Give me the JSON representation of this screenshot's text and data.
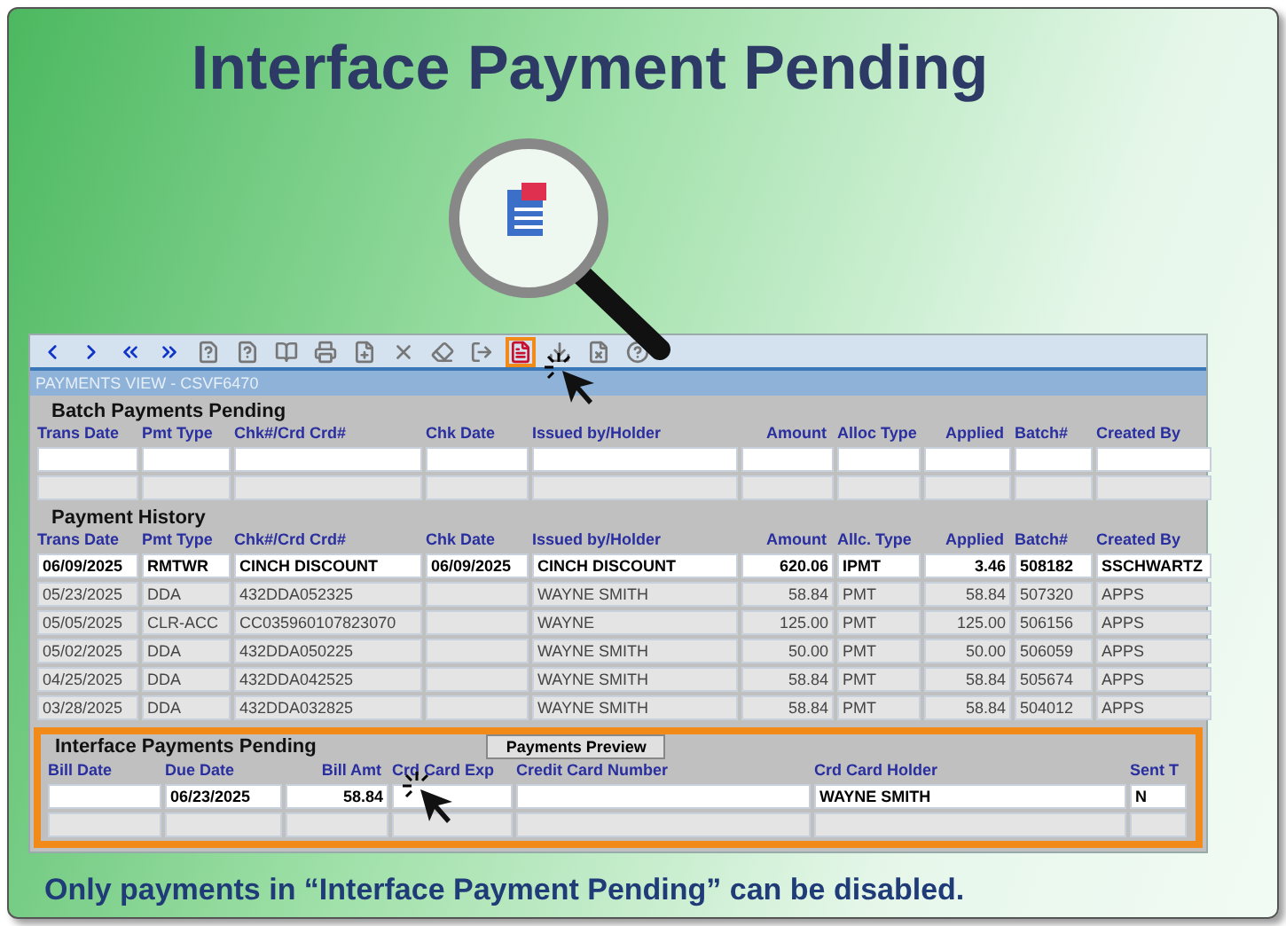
{
  "title": "Interface Payment Pending",
  "toolbar": [
    {
      "kind": "prev",
      "highlighted": false
    },
    {
      "kind": "next",
      "highlighted": false
    },
    {
      "kind": "first",
      "highlighted": false
    },
    {
      "kind": "last",
      "highlighted": false
    },
    {
      "kind": "query",
      "highlighted": false
    },
    {
      "kind": "query",
      "highlighted": false
    },
    {
      "kind": "book",
      "highlighted": false
    },
    {
      "kind": "print",
      "highlighted": false
    },
    {
      "kind": "new",
      "highlighted": false
    },
    {
      "kind": "delete",
      "highlighted": false
    },
    {
      "kind": "erase",
      "highlighted": false
    },
    {
      "kind": "exit",
      "highlighted": false
    },
    {
      "kind": "payments",
      "highlighted": true
    },
    {
      "kind": "download",
      "highlighted": false
    },
    {
      "kind": "clear",
      "highlighted": false
    },
    {
      "kind": "help",
      "highlighted": false
    }
  ],
  "window_title": "PAYMENTS VIEW - CSVF6470",
  "batch": {
    "heading": "Batch Payments Pending",
    "columns": [
      {
        "label": "Trans Date",
        "kind": "text"
      },
      {
        "label": "Pmt Type",
        "kind": "text"
      },
      {
        "label": "Chk#/Crd Crd#",
        "kind": "text"
      },
      {
        "label": "Chk Date",
        "kind": "text"
      },
      {
        "label": "Issued by/Holder",
        "kind": "text"
      },
      {
        "label": "Amount",
        "kind": "number"
      },
      {
        "label": "Alloc Type",
        "kind": "text"
      },
      {
        "label": "Applied",
        "kind": "number"
      },
      {
        "label": "Batch#",
        "kind": "text"
      },
      {
        "label": "Created By",
        "kind": "text"
      }
    ]
  },
  "history": {
    "heading": "Payment History",
    "columns": [
      {
        "label": "Trans Date",
        "kind": "text"
      },
      {
        "label": "Pmt Type",
        "kind": "text"
      },
      {
        "label": "Chk#/Crd Crd#",
        "kind": "text"
      },
      {
        "label": "Chk Date",
        "kind": "text"
      },
      {
        "label": "Issued by/Holder",
        "kind": "text"
      },
      {
        "label": "Amount",
        "kind": "number"
      },
      {
        "label": "Allc. Type",
        "kind": "text"
      },
      {
        "label": "Applied",
        "kind": "number"
      },
      {
        "label": "Batch#",
        "kind": "text"
      },
      {
        "label": "Created By",
        "kind": "text"
      }
    ],
    "rows": [
      {
        "selected": true,
        "cells": [
          "06/09/2025",
          "RMTWR",
          "CINCH DISCOUNT",
          "06/09/2025",
          "CINCH DISCOUNT",
          "620.06",
          "IPMT",
          "3.46",
          "508182",
          "SSCHWARTZ"
        ]
      },
      {
        "selected": false,
        "cells": [
          "05/23/2025",
          "DDA",
          "432DDA052325",
          "",
          "WAYNE SMITH",
          "58.84",
          "PMT",
          "58.84",
          "507320",
          "APPS"
        ]
      },
      {
        "selected": false,
        "cells": [
          "05/05/2025",
          "CLR-ACC",
          "CC035960107823070",
          "",
          "WAYNE",
          "125.00",
          "PMT",
          "125.00",
          "506156",
          "APPS"
        ]
      },
      {
        "selected": false,
        "cells": [
          "05/02/2025",
          "DDA",
          "432DDA050225",
          "",
          "WAYNE SMITH",
          "50.00",
          "PMT",
          "50.00",
          "506059",
          "APPS"
        ]
      },
      {
        "selected": false,
        "cells": [
          "04/25/2025",
          "DDA",
          "432DDA042525",
          "",
          "WAYNE SMITH",
          "58.84",
          "PMT",
          "58.84",
          "505674",
          "APPS"
        ]
      },
      {
        "selected": false,
        "cells": [
          "03/28/2025",
          "DDA",
          "432DDA032825",
          "",
          "WAYNE SMITH",
          "58.84",
          "PMT",
          "58.84",
          "504012",
          "APPS"
        ]
      }
    ]
  },
  "interface": {
    "heading": "Interface Payments Pending",
    "preview_button": "Payments Preview",
    "columns": [
      {
        "label": "Bill Date",
        "kind": "text"
      },
      {
        "label": "Due Date",
        "kind": "text"
      },
      {
        "label": "Bill Amt",
        "kind": "number"
      },
      {
        "label": "Crd Card Exp",
        "kind": "text"
      },
      {
        "label": "Credit Card Number",
        "kind": "text"
      },
      {
        "label": "Crd Card Holder",
        "kind": "text"
      },
      {
        "label": "Sent T",
        "kind": "text"
      }
    ],
    "rows": [
      {
        "cells": [
          "",
          "06/23/2025",
          "58.84",
          "",
          "",
          "WAYNE SMITH",
          "N"
        ]
      }
    ]
  },
  "caption": "Only payments in “Interface Payment Pending” can be disabled."
}
